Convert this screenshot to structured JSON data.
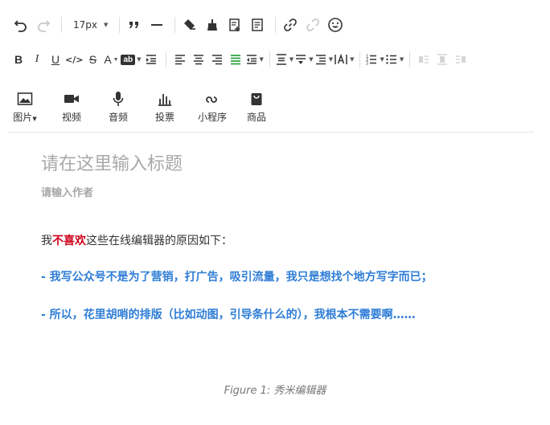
{
  "toolbar1": {
    "undo": "undo-icon",
    "redo": "redo-icon",
    "font_size": "17px",
    "quote": "””",
    "hr": "horizontal-rule-icon"
  },
  "toolbar2": {
    "bold": "B",
    "italic": "I",
    "underline": "U",
    "code": "</>",
    "strike": "S",
    "font_color": "A",
    "bg_color": "ab"
  },
  "media": [
    {
      "label": "图片"
    },
    {
      "label": "视频"
    },
    {
      "label": "音频"
    },
    {
      "label": "投票"
    },
    {
      "label": "小程序"
    },
    {
      "label": "商品"
    }
  ],
  "editor": {
    "title_placeholder": "请在这里输入标题",
    "author_placeholder": "请输入作者",
    "p1_a": "我",
    "p1_red": "不喜欢",
    "p1_b": "这些在线编辑器的原因如下：",
    "p2": "- 我写公众号不是为了营销，打广告，吸引流量，我只是想找个地方写字而已；",
    "p3": "- 所以，花里胡哨的排版（比如动图，引导条什么的），我根本不需要啊……"
  },
  "caption": "Figure 1: 秀米编辑器",
  "colors": {
    "accent": "#2f7dd6",
    "red": "#d0021b",
    "active_green": "#2ea043"
  }
}
